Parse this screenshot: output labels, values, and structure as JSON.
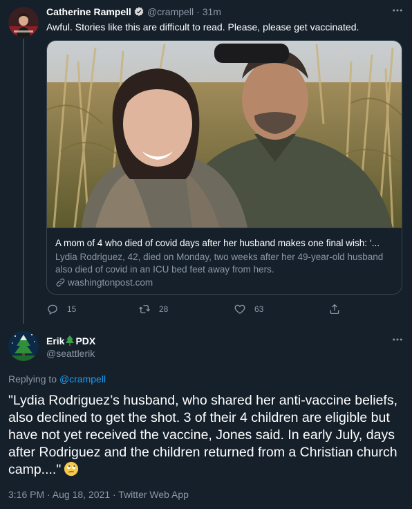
{
  "tweet1": {
    "author_name": "Catherine Rampell",
    "handle": "@crampell",
    "separator": "·",
    "time": "31m",
    "text": "Awful. Stories like this are difficult to read. Please, please get vaccinated.",
    "card": {
      "title": "A mom of 4 who died of covid days after her husband makes one final wish: ‘...",
      "description": "Lydia Rodriguez, 42, died on Monday, two weeks after her 49-year-old husband also died of covid in an ICU bed feet away from hers.",
      "domain": "washingtonpost.com"
    },
    "actions": {
      "replies": "15",
      "retweets": "28",
      "likes": "63"
    }
  },
  "tweet2": {
    "author_name": "Erik",
    "name_emoji": "🌲",
    "author_name_suffix": "PDX",
    "handle": "@seattlerik",
    "replying_prefix": "Replying to",
    "replying_to": "@crampell",
    "text": "\"Lydia Rodriguez’s husband, who shared her anti-vaccine beliefs, also declined to get the shot. 3 of their 4 children are eligible but have not yet received the vaccine, Jones said. In early July, days after Rodriguez and the children returned from a Christian church camp....\"",
    "timestamp": "3:16 PM · Aug 18, 2021 · Twitter Web App"
  },
  "icons": {
    "verified": "verified-badge-icon",
    "more": "more-horizontal-icon",
    "reply": "reply-icon",
    "retweet": "retweet-icon",
    "like": "heart-icon",
    "share": "share-icon",
    "link": "link-icon",
    "emoji": "face-with-rolling-eyes-emoji"
  },
  "colors": {
    "background": "#15202b",
    "border": "#38444d",
    "muted": "#8b98a5",
    "accent": "#1d9bf0"
  }
}
